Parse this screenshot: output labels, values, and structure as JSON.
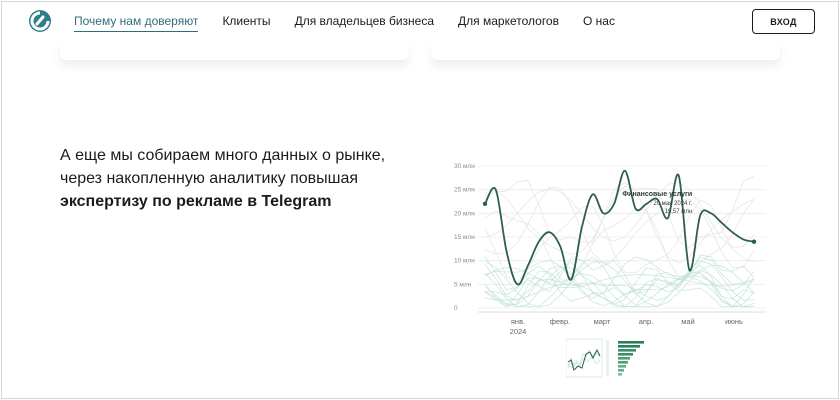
{
  "header": {
    "nav": [
      {
        "label": "Почему нам доверяют",
        "active": true
      },
      {
        "label": "Клиенты",
        "active": false
      },
      {
        "label": "Для владельцев бизнеса",
        "active": false
      },
      {
        "label": "Для маркетологов",
        "active": false
      },
      {
        "label": "О нас",
        "active": false
      }
    ],
    "login_label": "ВХОД"
  },
  "main": {
    "headline_line1": "А еще мы собираем много данных о рынке,",
    "headline_line2": "через накопленную аналитику повышая",
    "headline_bold": "экспертизу по рекламе в Telegram"
  },
  "colors": {
    "accent": "#2f6f7a",
    "highlight_line": "#2e5e4e",
    "background_lines": "#b9e0cf"
  },
  "chart_data": {
    "type": "line",
    "y_ticks": [
      "30 млн",
      "25 млн",
      "20 млн",
      "15 млн",
      "10 млн",
      "5 млн",
      "0"
    ],
    "ylim": [
      0,
      30
    ],
    "x_ticks": [
      "янв.",
      "февр.",
      "март",
      "апр.",
      "май",
      "июнь"
    ],
    "x_tick_year": "2024",
    "series": [
      {
        "name": "Финансовые услуги",
        "highlighted": true,
        "x": [
          "2024-01-01",
          "2024-01-08",
          "2024-01-15",
          "2024-01-22",
          "2024-01-29",
          "2024-02-05",
          "2024-02-12",
          "2024-02-19",
          "2024-02-26",
          "2024-03-04",
          "2024-03-11",
          "2024-03-18",
          "2024-03-25",
          "2024-04-01",
          "2024-04-08",
          "2024-04-15",
          "2024-04-22",
          "2024-04-29",
          "2024-05-06",
          "2024-05-13",
          "2024-05-20",
          "2024-05-27",
          "2024-06-03",
          "2024-06-10",
          "2024-06-17",
          "2024-06-24"
        ],
        "values": [
          22,
          25,
          12,
          5,
          9,
          14,
          16,
          13,
          6,
          17,
          24,
          20,
          22,
          29,
          21,
          22,
          23,
          19,
          28,
          8,
          19.57,
          20,
          18,
          16,
          14.5,
          14
        ]
      }
    ],
    "tooltip": {
      "title": "Финансовые услуги",
      "date": "20 мая 2024 г.",
      "value": "19,57 млн"
    }
  }
}
